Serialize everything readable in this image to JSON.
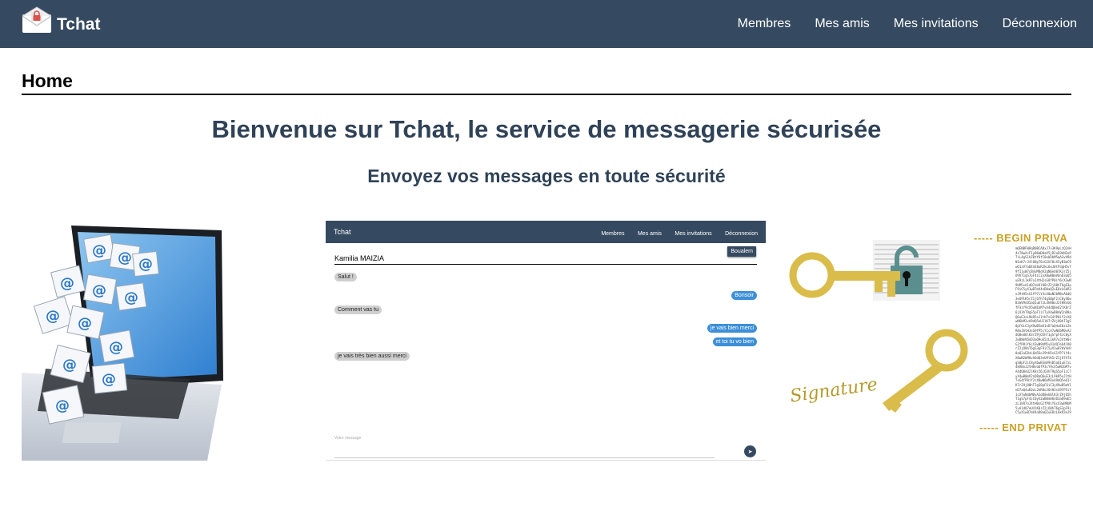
{
  "app": {
    "brand": "Tchat",
    "brand_icon": "lock-envelope-icon"
  },
  "nav": {
    "items": [
      {
        "label": "Membres"
      },
      {
        "label": "Mes amis"
      },
      {
        "label": "Mes invitations"
      },
      {
        "label": "Déconnexion"
      }
    ]
  },
  "page": {
    "title": "Home",
    "headline": "Bienvenue sur Tchat, le service de messagerie sécurisée",
    "subheadline": "Envoyez vos messages en toute sécurité"
  },
  "colors": {
    "navbar": "#354a60",
    "heading": "#2f4257",
    "gold": "#c9a227",
    "bubble_out": "#3c8fd8",
    "bubble_in": "#cfcfcf"
  },
  "preview_app": {
    "brand": "Tchat",
    "nav": [
      "Membres",
      "Mes amis",
      "Mes invitations",
      "Déconnexion"
    ],
    "user_button": "Boualem",
    "contact": "Kamilia MAIZIA",
    "messages": [
      {
        "text": "Salut !",
        "dir": "in"
      },
      {
        "text": "Bonsoir",
        "dir": "out"
      },
      {
        "text": "Comment vas tu",
        "dir": "in"
      },
      {
        "text": "je vais bien merci",
        "dir": "out"
      },
      {
        "text": "et toi tu vo bien",
        "dir": "out"
      },
      {
        "text": "je vais très bien aussi merci",
        "dir": "in"
      }
    ],
    "input_label": "Votre message",
    "send_icon": "send-icon"
  },
  "crypto_image": {
    "begin": "----- BEGIN PRIVA",
    "end": "----- END PRIVAT",
    "signature": "Signature"
  }
}
